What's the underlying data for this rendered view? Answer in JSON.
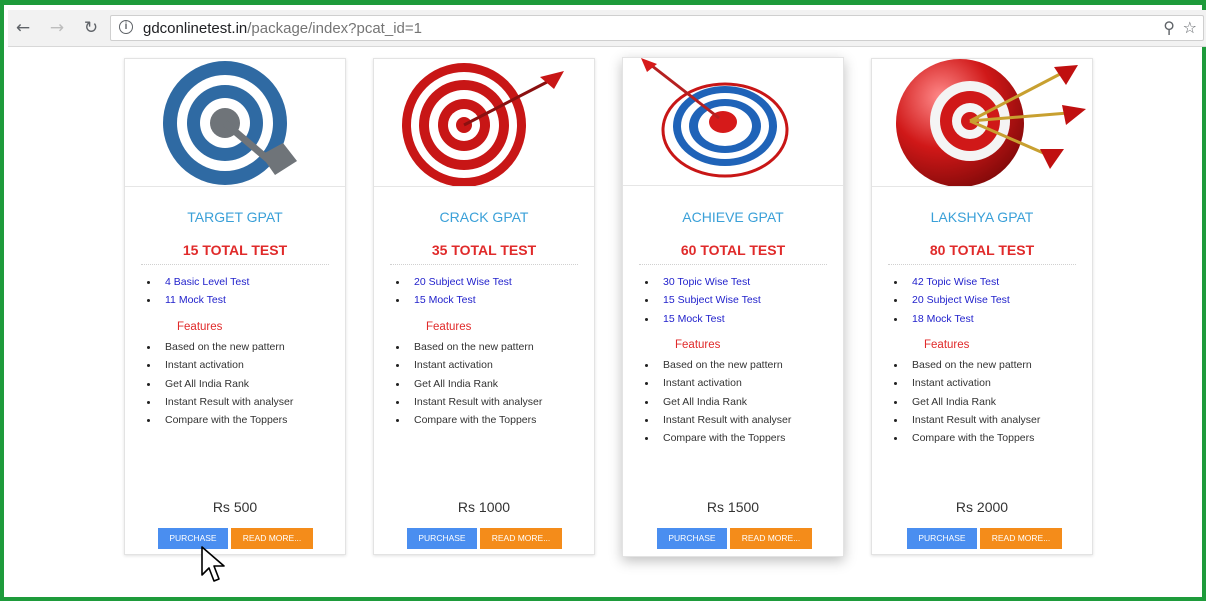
{
  "browser": {
    "url_host": "gdconlinetest.in",
    "url_path": "/package/index?pcat_id=1",
    "icons": {
      "back": "back-arrow-icon",
      "forward": "forward-arrow-icon",
      "reload": "reload-icon",
      "info": "info-icon",
      "zoom": "zoom-icon",
      "star": "bookmark-star-icon"
    }
  },
  "colors": {
    "frame_border": "#1e9b3b",
    "title": "#3aa0d8",
    "total": "#e02a2a",
    "test_items": "#2222cc",
    "purchase_button": "#4a8ef0",
    "readmore_button": "#f48c1a"
  },
  "packages": [
    {
      "name": "TARGET GPAT",
      "total": "15 TOTAL TEST",
      "tests": [
        "4 Basic Level Test",
        "11 Mock Test"
      ],
      "features_heading": "Features",
      "features": [
        "Based on the new pattern",
        "Instant activation",
        "Get All India Rank",
        "Instant Result with analyser",
        "Compare with the Toppers"
      ],
      "price": "Rs 500",
      "purchase_label": "PURCHASE",
      "readmore_label": "READ MORE...",
      "image_icon": "blue-target-icon"
    },
    {
      "name": "CRACK GPAT",
      "total": "35 TOTAL TEST",
      "tests": [
        "20 Subject Wise Test",
        "15 Mock Test"
      ],
      "features_heading": "Features",
      "features": [
        "Based on the new pattern",
        "Instant activation",
        "Get All India Rank",
        "Instant Result with analyser",
        "Compare with the Toppers"
      ],
      "price": "Rs 1000",
      "purchase_label": "PURCHASE",
      "readmore_label": "READ MORE...",
      "image_icon": "red-dartboard-icon"
    },
    {
      "name": "ACHIEVE GPAT",
      "total": "60 TOTAL TEST",
      "tests": [
        "30 Topic Wise Test",
        "15 Subject Wise Test",
        "15 Mock Test"
      ],
      "features_heading": "Features",
      "features": [
        "Based on the new pattern",
        "Instant activation",
        "Get All India Rank",
        "Instant Result with analyser",
        "Compare with the Toppers"
      ],
      "price": "Rs 1500",
      "purchase_label": "PURCHASE",
      "readmore_label": "READ MORE...",
      "image_icon": "blue-bullseye-arrow-icon"
    },
    {
      "name": "LAKSHYA GPAT",
      "total": "80 TOTAL TEST",
      "tests": [
        "42 Topic Wise Test",
        "20 Subject Wise Test",
        "18 Mock Test"
      ],
      "features_heading": "Features",
      "features": [
        "Based on the new pattern",
        "Instant activation",
        "Get All India Rank",
        "Instant Result with analyser",
        "Compare with the Toppers"
      ],
      "price": "Rs 2000",
      "purchase_label": "PURCHASE",
      "readmore_label": "READ MORE...",
      "image_icon": "red-ball-darts-icon"
    }
  ]
}
